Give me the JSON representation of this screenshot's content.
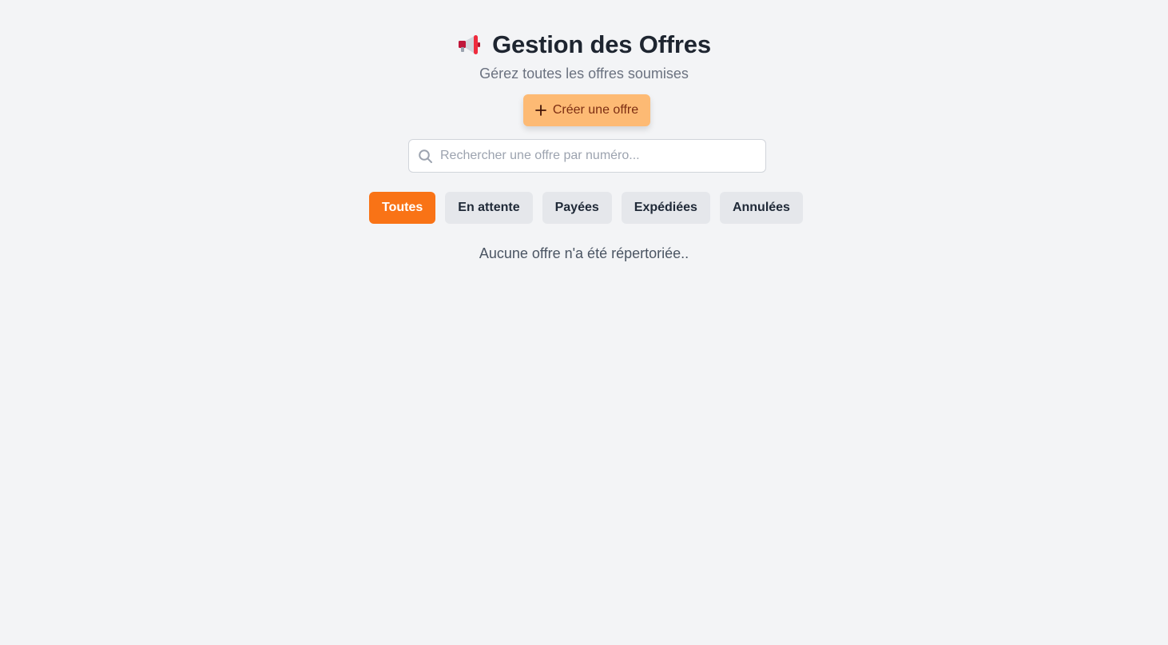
{
  "header": {
    "title": "Gestion des Offres",
    "subtitle": "Gérez toutes les offres soumises",
    "icon": "megaphone-icon"
  },
  "actions": {
    "create_label": "Créer une offre",
    "create_icon": "plus-icon"
  },
  "search": {
    "placeholder": "Rechercher une offre par numéro...",
    "value": "",
    "icon": "search-icon"
  },
  "filters": {
    "tabs": [
      {
        "label": "Toutes",
        "active": true
      },
      {
        "label": "En attente",
        "active": false
      },
      {
        "label": "Payées",
        "active": false
      },
      {
        "label": "Expédiées",
        "active": false
      },
      {
        "label": "Annulées",
        "active": false
      }
    ]
  },
  "empty_state": {
    "message": "Aucune offre n'a été répertoriée.."
  },
  "colors": {
    "accent": "#f97316",
    "create_button_bg": "#fdba74",
    "background": "#f3f4f6"
  }
}
